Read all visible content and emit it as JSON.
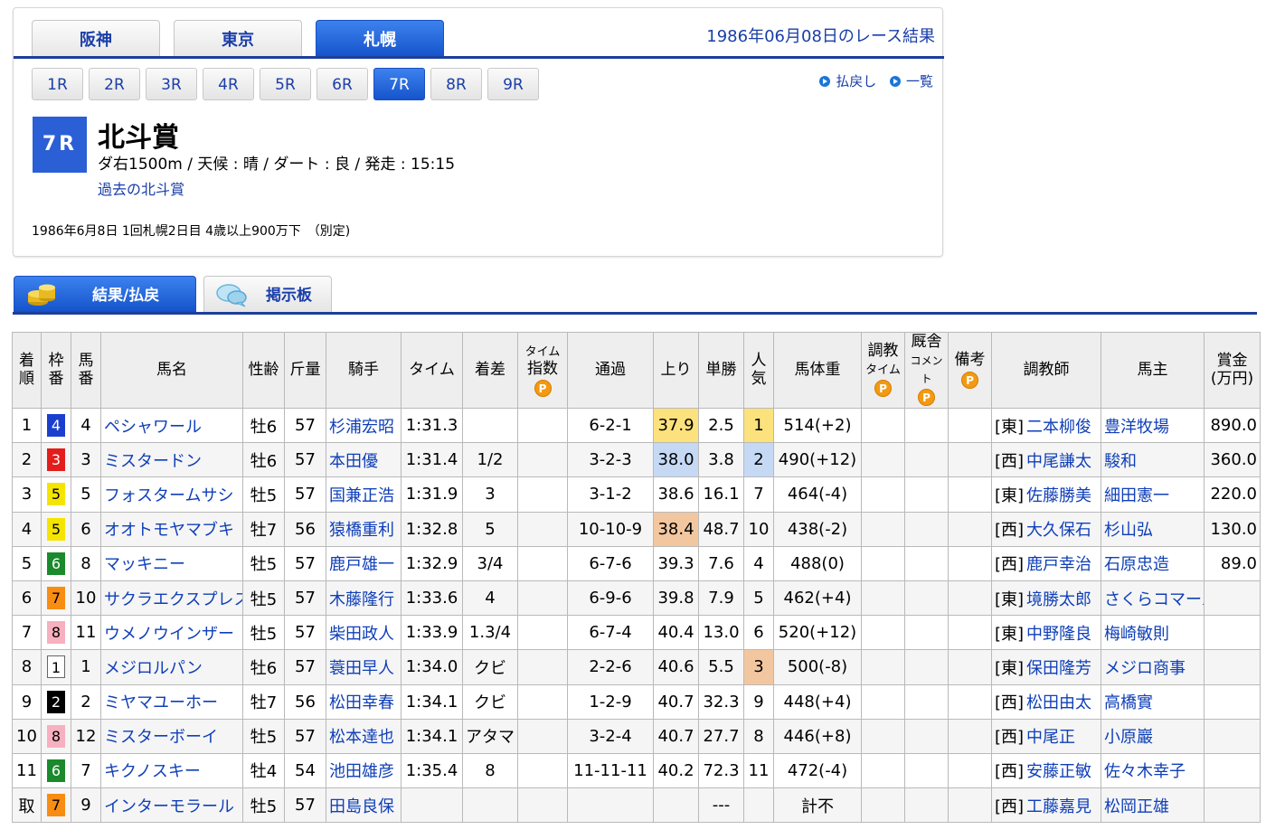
{
  "course_tabs": [
    {
      "label": "阪神",
      "active": false
    },
    {
      "label": "東京",
      "active": false
    },
    {
      "label": "札幌",
      "active": true
    }
  ],
  "race_date_title": "1986年06月08日のレース結果",
  "race_tabs": [
    {
      "label": "1R",
      "active": false
    },
    {
      "label": "2R",
      "active": false
    },
    {
      "label": "3R",
      "active": false
    },
    {
      "label": "4R",
      "active": false
    },
    {
      "label": "5R",
      "active": false
    },
    {
      "label": "6R",
      "active": false
    },
    {
      "label": "7R",
      "active": true
    },
    {
      "label": "8R",
      "active": false
    },
    {
      "label": "9R",
      "active": false
    }
  ],
  "top_links": {
    "payout": "払戻し",
    "list": "一覧"
  },
  "race": {
    "number": "7R",
    "name": "北斗賞",
    "conditions": "ダ右1500m / 天候 : 晴 / ダート : 良 / 発走 : 15:15",
    "past_link": "過去の北斗賞",
    "info": "1986年6月8日 1回札幌2日目 4歳以上900万下　（別定)"
  },
  "sub_tabs": {
    "results": "結果/払戻",
    "board": "掲示板"
  },
  "table": {
    "headers": {
      "order": [
        "着",
        "順"
      ],
      "waku": [
        "枠",
        "番"
      ],
      "umaban": [
        "馬",
        "番"
      ],
      "horse": "馬名",
      "sexage": "性齢",
      "weight": "斤量",
      "jockey": "騎手",
      "time": "タイム",
      "margin": "着差",
      "time_index": [
        "タイム",
        "指数"
      ],
      "passing": "通過",
      "last3f": "上り",
      "odds": "単勝",
      "popularity": [
        "人",
        "気"
      ],
      "body_weight": "馬体重",
      "training_time": [
        "調教",
        "タイム"
      ],
      "stable_comment": [
        "厩舎",
        "コメント"
      ],
      "remarks": "備考",
      "trainer": "調教師",
      "owner": "馬主",
      "prize": [
        "賞金",
        "(万円)"
      ],
      "p_mark": "P"
    },
    "rows": [
      {
        "order": "1",
        "waku": "4",
        "umaban": "4",
        "horse": "ペシャワール",
        "sexage": "牡6",
        "weight": "57",
        "jockey": "杉浦宏昭",
        "time": "1:31.3",
        "margin": "",
        "passing": "6-2-1",
        "last3f": "37.9",
        "odds": "2.5",
        "popularity": "1",
        "body_weight": "514(+2)",
        "region": "[東]",
        "trainer": "二本柳俊",
        "owner": "豊洋牧場",
        "prize": "890.0"
      },
      {
        "order": "2",
        "waku": "3",
        "umaban": "3",
        "horse": "ミスタードン",
        "sexage": "牡6",
        "weight": "57",
        "jockey": "本田優",
        "time": "1:31.4",
        "margin": "1/2",
        "passing": "3-2-3",
        "last3f": "38.0",
        "odds": "3.8",
        "popularity": "2",
        "body_weight": "490(+12)",
        "region": "[西]",
        "trainer": "中尾謙太",
        "owner": "駿和",
        "prize": "360.0"
      },
      {
        "order": "3",
        "waku": "5",
        "umaban": "5",
        "horse": "フォスタームサシ",
        "sexage": "牡5",
        "weight": "57",
        "jockey": "国兼正浩",
        "time": "1:31.9",
        "margin": "3",
        "passing": "3-1-2",
        "last3f": "38.6",
        "odds": "16.1",
        "popularity": "7",
        "body_weight": "464(-4)",
        "region": "[東]",
        "trainer": "佐藤勝美",
        "owner": "細田憲一",
        "prize": "220.0"
      },
      {
        "order": "4",
        "waku": "5",
        "umaban": "6",
        "horse": "オオトモヤマブキ",
        "sexage": "牡7",
        "weight": "56",
        "jockey": "猿橋重利",
        "time": "1:32.8",
        "margin": "5",
        "passing": "10-10-9",
        "last3f": "38.4",
        "odds": "48.7",
        "popularity": "10",
        "body_weight": "438(-2)",
        "region": "[西]",
        "trainer": "大久保石",
        "owner": "杉山弘",
        "prize": "130.0"
      },
      {
        "order": "5",
        "waku": "6",
        "umaban": "8",
        "horse": "マッキニー",
        "sexage": "牡5",
        "weight": "57",
        "jockey": "鹿戸雄一",
        "time": "1:32.9",
        "margin": "3/4",
        "passing": "6-7-6",
        "last3f": "39.3",
        "odds": "7.6",
        "popularity": "4",
        "body_weight": "488(0)",
        "region": "[西]",
        "trainer": "鹿戸幸治",
        "owner": "石原忠造",
        "prize": "89.0"
      },
      {
        "order": "6",
        "waku": "7",
        "umaban": "10",
        "horse": "サクラエクスプレス",
        "sexage": "牡5",
        "weight": "57",
        "jockey": "木藤隆行",
        "time": "1:33.6",
        "margin": "4",
        "passing": "6-9-6",
        "last3f": "39.8",
        "odds": "7.9",
        "popularity": "5",
        "body_weight": "462(+4)",
        "region": "[東]",
        "trainer": "境勝太郎",
        "owner": "さくらコマース",
        "prize": ""
      },
      {
        "order": "7",
        "waku": "8",
        "umaban": "11",
        "horse": "ウメノウインザー",
        "sexage": "牡5",
        "weight": "57",
        "jockey": "柴田政人",
        "time": "1:33.9",
        "margin": "1.3/4",
        "passing": "6-7-4",
        "last3f": "40.4",
        "odds": "13.0",
        "popularity": "6",
        "body_weight": "520(+12)",
        "region": "[東]",
        "trainer": "中野隆良",
        "owner": "梅崎敏則",
        "prize": ""
      },
      {
        "order": "8",
        "waku": "1",
        "umaban": "1",
        "horse": "メジロルパン",
        "sexage": "牡6",
        "weight": "57",
        "jockey": "蓑田早人",
        "time": "1:34.0",
        "margin": "クビ",
        "passing": "2-2-6",
        "last3f": "40.6",
        "odds": "5.5",
        "popularity": "3",
        "body_weight": "500(-8)",
        "region": "[東]",
        "trainer": "保田隆芳",
        "owner": "メジロ商事",
        "prize": ""
      },
      {
        "order": "9",
        "waku": "2",
        "umaban": "2",
        "horse": "ミヤマユーホー",
        "sexage": "牡7",
        "weight": "56",
        "jockey": "松田幸春",
        "time": "1:34.1",
        "margin": "クビ",
        "passing": "1-2-9",
        "last3f": "40.7",
        "odds": "32.3",
        "popularity": "9",
        "body_weight": "448(+4)",
        "region": "[西]",
        "trainer": "松田由太",
        "owner": "高橋實",
        "prize": ""
      },
      {
        "order": "10",
        "waku": "8",
        "umaban": "12",
        "horse": "ミスターボーイ",
        "sexage": "牡5",
        "weight": "57",
        "jockey": "松本達也",
        "time": "1:34.1",
        "margin": "アタマ",
        "passing": "3-2-4",
        "last3f": "40.7",
        "odds": "27.7",
        "popularity": "8",
        "body_weight": "446(+8)",
        "region": "[西]",
        "trainer": "中尾正",
        "owner": "小原巖",
        "prize": ""
      },
      {
        "order": "11",
        "waku": "6",
        "umaban": "7",
        "horse": "キクノスキー",
        "sexage": "牡4",
        "weight": "54",
        "jockey": "池田雄彦",
        "time": "1:35.4",
        "margin": "8",
        "passing": "11-11-11",
        "last3f": "40.2",
        "odds": "72.3",
        "popularity": "11",
        "body_weight": "472(-4)",
        "region": "[西]",
        "trainer": "安藤正敏",
        "owner": "佐々木幸子",
        "prize": ""
      },
      {
        "order": "取",
        "waku": "7",
        "umaban": "9",
        "horse": "インターモラール",
        "sexage": "牡5",
        "weight": "57",
        "jockey": "田島良保",
        "time": "",
        "margin": "",
        "passing": "",
        "last3f": "",
        "odds": "---",
        "popularity": "",
        "body_weight": "計不",
        "region": "[西]",
        "trainer": "工藤嘉見",
        "owner": "松岡正雄",
        "prize": ""
      }
    ]
  },
  "colors": {
    "accent_blue": "#1654cc",
    "link_blue": "#0f3fb8",
    "header_gray": "#eeeeee",
    "last3f_best": "#fbe27d",
    "last3f_second": "#c5d9f5",
    "last3f_third": "#f2c7a0"
  },
  "icons": [
    "play-circle-icon",
    "coins-icon",
    "speech-bubble-icon",
    "p-mark-icon"
  ]
}
